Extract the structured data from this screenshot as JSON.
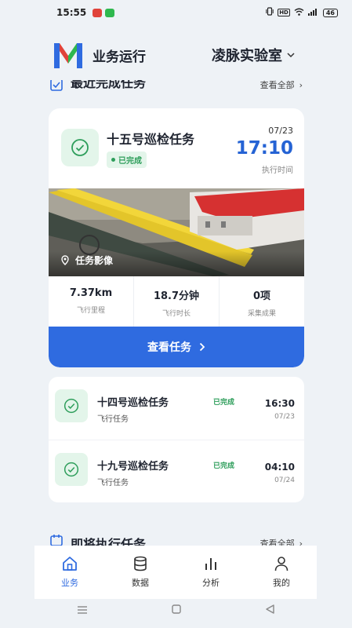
{
  "status_bar": {
    "time": "15:55",
    "battery": "46"
  },
  "header": {
    "app_title": "业务运行",
    "org_name": "凌脉实验室"
  },
  "recent_section": {
    "title": "最近完成任务",
    "view_all": "查看全部"
  },
  "featured_task": {
    "title": "十五号巡检任务",
    "status": "已完成",
    "date": "07/23",
    "time": "17:10",
    "time_label": "执行时间",
    "photo_caption": "任务影像",
    "stats": [
      {
        "value": "7.37km",
        "label": "飞行里程"
      },
      {
        "value": "18.7分钟",
        "label": "飞行时长"
      },
      {
        "value": "0项",
        "label": "采集成果"
      }
    ],
    "button_label": "查看任务"
  },
  "task_list": [
    {
      "title": "十四号巡检任务",
      "subtitle": "飞行任务",
      "status": "已完成",
      "time": "16:30",
      "date": "07/23"
    },
    {
      "title": "十九号巡检任务",
      "subtitle": "飞行任务",
      "status": "已完成",
      "time": "04:10",
      "date": "07/24"
    }
  ],
  "upcoming_section": {
    "title": "即将执行任务",
    "view_all": "查看全部"
  },
  "bottom_nav": [
    {
      "label": "业务",
      "icon": "home-icon",
      "active": true
    },
    {
      "label": "数据",
      "icon": "database-icon",
      "active": false
    },
    {
      "label": "分析",
      "icon": "bar-chart-icon",
      "active": false
    },
    {
      "label": "我的",
      "icon": "user-icon",
      "active": false
    }
  ],
  "colors": {
    "accent": "#2f6be0",
    "success": "#2e9e5b",
    "success_bg": "#e3f5ea"
  }
}
